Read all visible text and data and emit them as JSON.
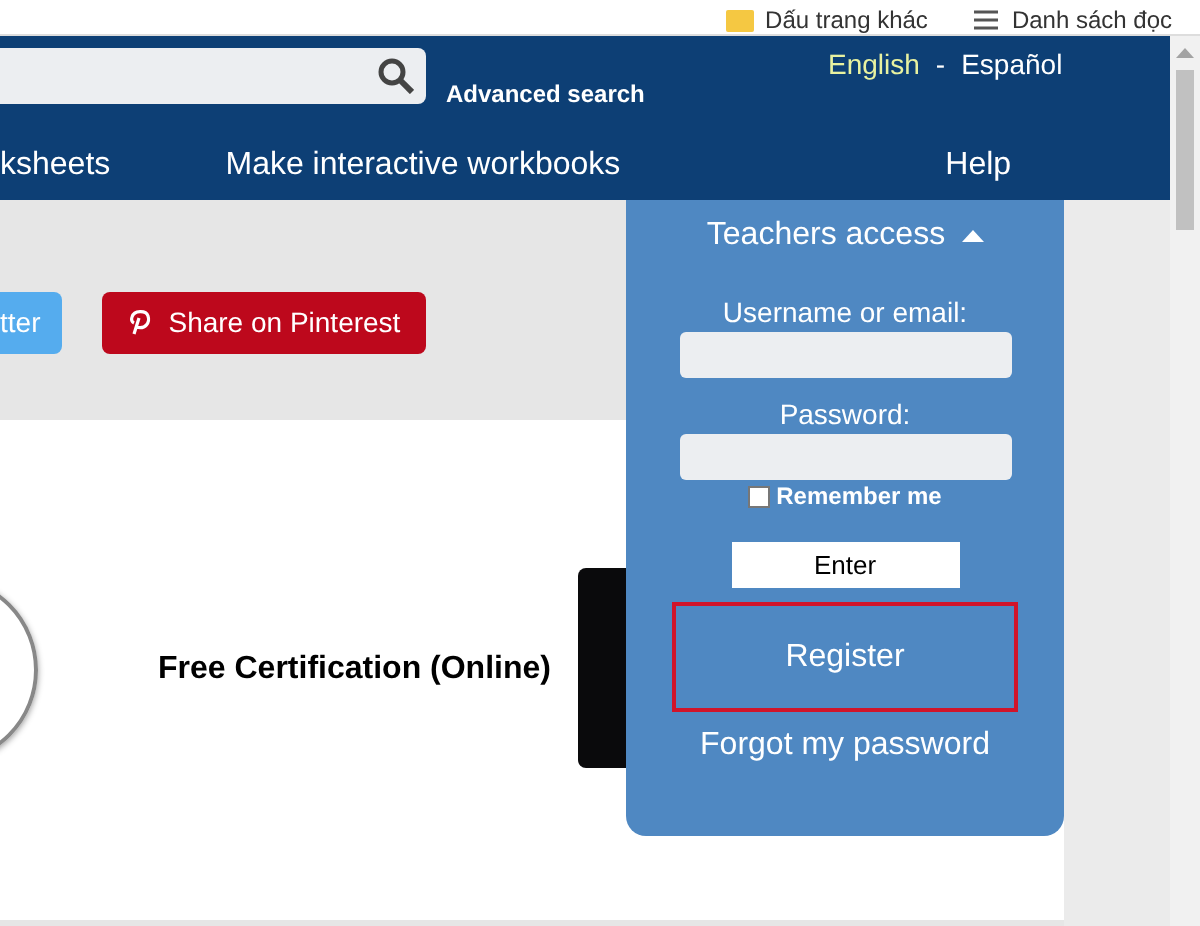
{
  "bookmarks": [
    {
      "label": "Dấu trang khác",
      "kind": "folder"
    },
    {
      "label": "Danh sách đọc",
      "kind": "list"
    }
  ],
  "header": {
    "advanced_search": "Advanced search",
    "languages": [
      {
        "label": "English",
        "selected": true
      },
      {
        "label": "Español",
        "selected": false
      }
    ],
    "separator": "-"
  },
  "nav": [
    "ksheets",
    "Make interactive workbooks",
    "Help"
  ],
  "share_buttons": [
    {
      "label": "tter",
      "kind": "twitter"
    },
    {
      "label": "Share on Pinterest",
      "kind": "pinterest"
    }
  ],
  "content": {
    "title": "Free Certification (Online)"
  },
  "login": {
    "title": "Teachers access",
    "expanded": true,
    "username_label": "Username or email:",
    "password_label": "Password:",
    "remember": {
      "label": "Remember me",
      "checked": false
    },
    "enter": "Enter",
    "register": "Register",
    "forgot": "Forgot my password"
  }
}
